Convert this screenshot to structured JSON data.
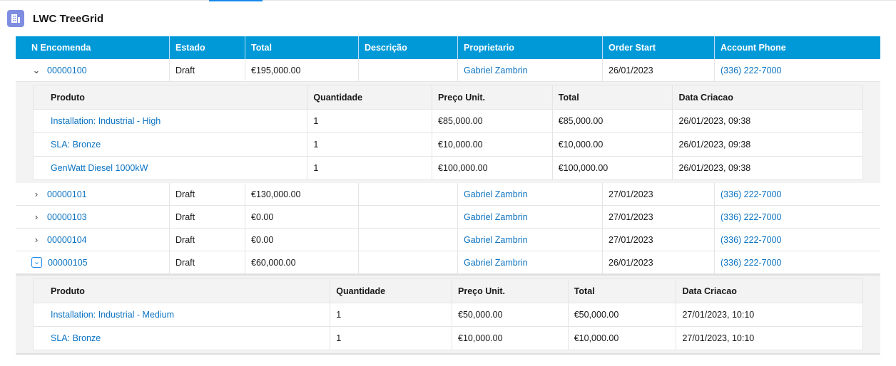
{
  "card": {
    "title": "LWC TreeGrid",
    "icon": "grid-app-icon"
  },
  "columns": [
    "N Encomenda",
    "Estado",
    "Total",
    "Descrição",
    "Proprietario",
    "Order Start",
    "Account Phone"
  ],
  "orders": [
    {
      "number": "00000100",
      "status": "Draft",
      "total": "€195,000.00",
      "description": "",
      "owner": "Gabriel Zambrin",
      "start": "26/01/2023",
      "phone": "(336) 222-7000",
      "expanded": true
    },
    {
      "number": "00000101",
      "status": "Draft",
      "total": "€130,000.00",
      "description": "",
      "owner": "Gabriel Zambrin",
      "start": "27/01/2023",
      "phone": "(336) 222-7000",
      "expanded": false
    },
    {
      "number": "00000103",
      "status": "Draft",
      "total": "€0.00",
      "description": "",
      "owner": "Gabriel Zambrin",
      "start": "27/01/2023",
      "phone": "(336) 222-7000",
      "expanded": false
    },
    {
      "number": "00000104",
      "status": "Draft",
      "total": "€0.00",
      "description": "",
      "owner": "Gabriel Zambrin",
      "start": "27/01/2023",
      "phone": "(336) 222-7000",
      "expanded": false
    },
    {
      "number": "00000105",
      "status": "Draft",
      "total": "€60,000.00",
      "description": "",
      "owner": "Gabriel Zambrin",
      "start": "26/01/2023",
      "phone": "(336) 222-7000",
      "expanded": true
    }
  ],
  "subColumns": [
    "Produto",
    "Quantidade",
    "Preço Unit.",
    "Total",
    "Data Criacao"
  ],
  "sub100": [
    {
      "product": "Installation: Industrial - High",
      "qty": "1",
      "price": "€85,000.00",
      "total": "€85,000.00",
      "created": "26/01/2023, 09:38"
    },
    {
      "product": "SLA: Bronze",
      "qty": "1",
      "price": "€10,000.00",
      "total": "€10,000.00",
      "created": "26/01/2023, 09:38"
    },
    {
      "product": "GenWatt Diesel 1000kW",
      "qty": "1",
      "price": "€100,000.00",
      "total": "€100,000.00",
      "created": "26/01/2023, 09:38"
    }
  ],
  "sub105": [
    {
      "product": "Installation: Industrial - Medium",
      "qty": "1",
      "price": "€50,000.00",
      "total": "€50,000.00",
      "created": "27/01/2023, 10:10"
    },
    {
      "product": "SLA: Bronze",
      "qty": "1",
      "price": "€10,000.00",
      "total": "€10,000.00",
      "created": "27/01/2023, 10:10"
    }
  ],
  "colors": {
    "header": "#0099d8",
    "link": "#0b73c2",
    "icon": "#7f8de1"
  }
}
